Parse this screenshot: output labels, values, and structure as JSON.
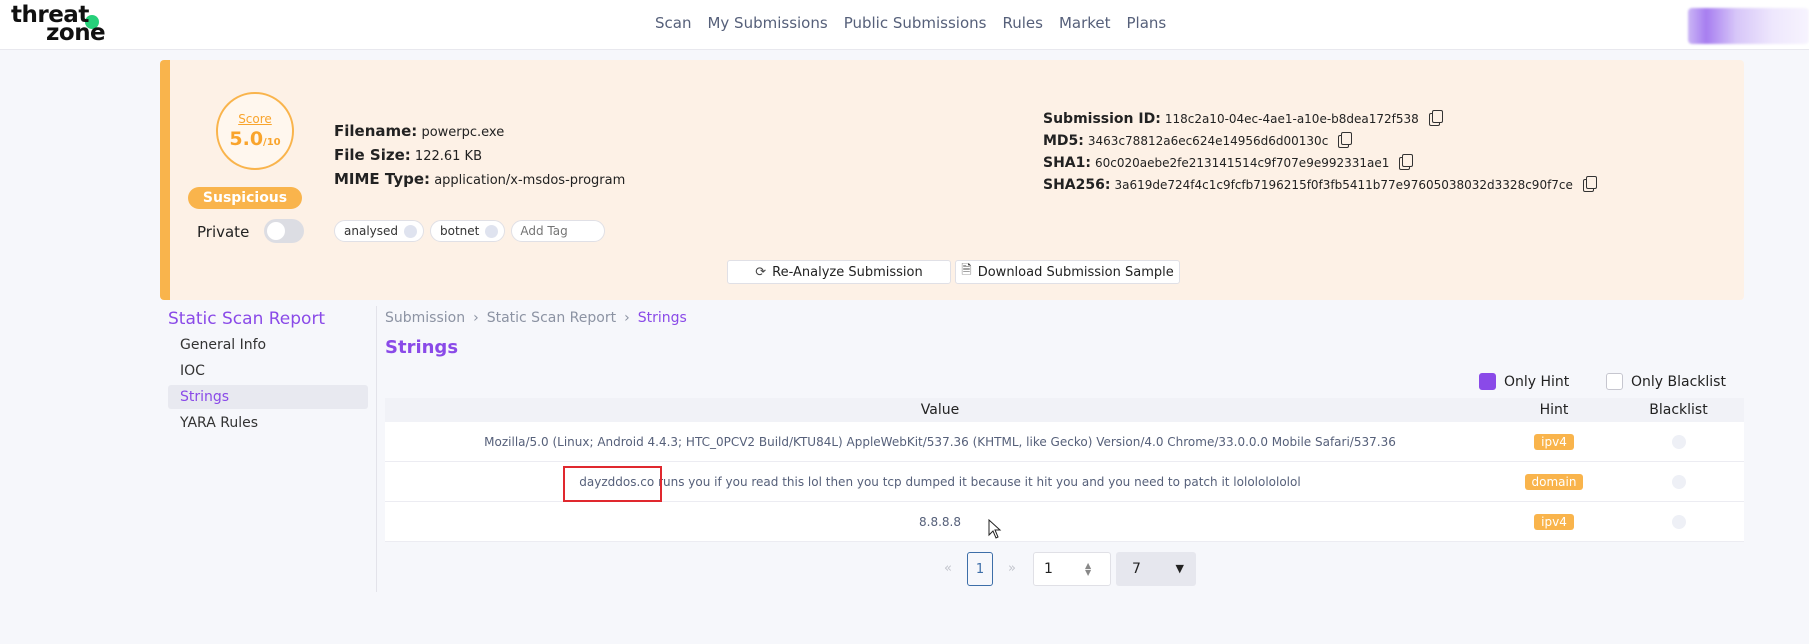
{
  "nav": {
    "logo_line1": "threat",
    "logo_line2": "zone",
    "items": [
      "Scan",
      "My Submissions",
      "Public Submissions",
      "Rules",
      "Market",
      "Plans"
    ]
  },
  "summary": {
    "score_label": "Score",
    "score_value": "5.0",
    "score_max": "/10",
    "verdict": "Suspicious",
    "private_label": "Private",
    "private_enabled": false,
    "filename_label": "Filename:",
    "filename": "powerpc.exe",
    "filesize_label": "File Size:",
    "filesize": "122.61 KB",
    "mime_label": "MIME Type:",
    "mime": "application/x-msdos-program",
    "tags": [
      "analysed",
      "botnet"
    ],
    "tag_placeholder": "Add Tag",
    "submission_id_label": "Submission ID:",
    "submission_id": "118c2a10-04ec-4ae1-a10e-b8dea172f538",
    "md5_label": "MD5:",
    "md5": "3463c78812a6ec624e14956d6d00130c",
    "sha1_label": "SHA1:",
    "sha1": "60c020aebe2fe213141514c9f707e9e992331ae1",
    "sha256_label": "SHA256:",
    "sha256": "3a619de724f4c1c9fcfb7196215f0f3fb5411b77e97605038032d3328c90f7ce",
    "reanalyze_label": "Re-Analyze Submission",
    "download_label": "Download Submission Sample",
    "accent_color": "#f9b44c"
  },
  "sidebar": {
    "title": "Static Scan Report",
    "items": [
      "General Info",
      "IOC",
      "Strings",
      "YARA Rules"
    ],
    "active_index": 2
  },
  "breadcrumb": [
    "Submission",
    "Static Scan Report",
    "Strings"
  ],
  "page_title": "Strings",
  "filters": {
    "only_hint_label": "Only Hint",
    "only_hint_checked": true,
    "only_blacklist_label": "Only Blacklist",
    "only_blacklist_checked": false
  },
  "table": {
    "headers": [
      "Value",
      "Hint",
      "Blacklist"
    ],
    "rows": [
      {
        "value": "Mozilla/5.0 (Linux; Android 4.4.3; HTC_0PCV2 Build/KTU84L) AppleWebKit/537.36 (KHTML, like Gecko) Version/4.0 Chrome/33.0.0.0 Mobile Safari/537.36",
        "hint": "ipv4"
      },
      {
        "value": "dayzddos.co runs you if you read this lol then you tcp dumped it because it hit you and you need to patch it lolololololol",
        "hint": "domain"
      },
      {
        "value": "8.8.8.8",
        "hint": "ipv4"
      }
    ]
  },
  "pagination": {
    "prev": "«",
    "current": "1",
    "next": "»",
    "page_input": "1",
    "page_size": "7"
  },
  "colors": {
    "brand_purple": "#8a4ae8",
    "hint_badge": "#f9b44c",
    "highlight_box": "#e0282e"
  }
}
